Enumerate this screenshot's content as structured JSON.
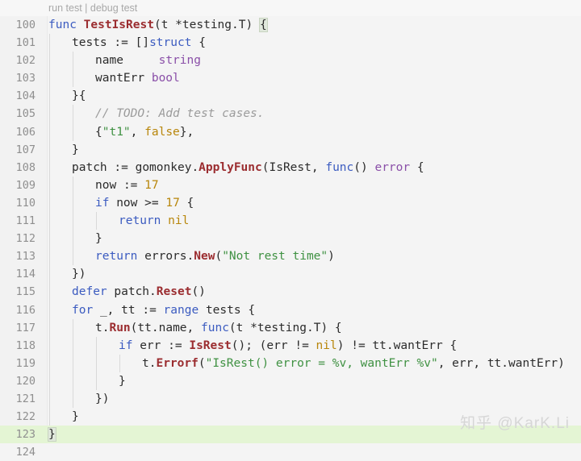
{
  "gutter_header": {
    "run_label": "run test",
    "separator": " | ",
    "debug_label": "debug test"
  },
  "watermark": "知乎 @KarK.Li",
  "colors": {
    "background": "#f4f4f4",
    "gutter": "#f2f2f2",
    "line_number": "#8f8f8f",
    "highlight_line": "#e4f5d4",
    "keyword": "#3b5bc0",
    "function": "#9b2d30",
    "type": "#8a4fa8",
    "string": "#3f9142",
    "number": "#b8860b",
    "comment": "#9b9b9b",
    "plain": "#2b2b2b",
    "brace_match": "#e0e8dc",
    "watermark": "#d6d6d6"
  },
  "editor": {
    "language": "go",
    "first_line": 100,
    "last_line": 124,
    "highlighted_lines": [
      123
    ],
    "lines": [
      {
        "n": "100",
        "indent": 0,
        "text": "func TestIsRest(t *testing.T) {"
      },
      {
        "n": "101",
        "indent": 1,
        "text": "tests := []struct {"
      },
      {
        "n": "102",
        "indent": 2,
        "text": "name     string"
      },
      {
        "n": "103",
        "indent": 2,
        "text": "wantErr bool"
      },
      {
        "n": "104",
        "indent": 1,
        "text": "}{"
      },
      {
        "n": "105",
        "indent": 2,
        "text": "// TODO: Add test cases."
      },
      {
        "n": "106",
        "indent": 2,
        "text": "{\"t1\", false},"
      },
      {
        "n": "107",
        "indent": 1,
        "text": "}"
      },
      {
        "n": "108",
        "indent": 1,
        "text": "patch := gomonkey.ApplyFunc(IsRest, func() error {"
      },
      {
        "n": "109",
        "indent": 2,
        "text": "now := 17"
      },
      {
        "n": "110",
        "indent": 2,
        "text": "if now >= 17 {"
      },
      {
        "n": "111",
        "indent": 3,
        "text": "return nil"
      },
      {
        "n": "112",
        "indent": 2,
        "text": "}"
      },
      {
        "n": "113",
        "indent": 2,
        "text": "return errors.New(\"Not rest time\")"
      },
      {
        "n": "114",
        "indent": 1,
        "text": "})"
      },
      {
        "n": "115",
        "indent": 1,
        "text": "defer patch.Reset()"
      },
      {
        "n": "116",
        "indent": 1,
        "text": "for _, tt := range tests {"
      },
      {
        "n": "117",
        "indent": 2,
        "text": "t.Run(tt.name, func(t *testing.T) {"
      },
      {
        "n": "118",
        "indent": 3,
        "text": "if err := IsRest(); (err != nil) != tt.wantErr {"
      },
      {
        "n": "119",
        "indent": 4,
        "text": "t.Errorf(\"IsRest() error = %v, wantErr %v\", err, tt.wantErr)"
      },
      {
        "n": "120",
        "indent": 3,
        "text": "}"
      },
      {
        "n": "121",
        "indent": 2,
        "text": "})"
      },
      {
        "n": "122",
        "indent": 1,
        "text": "}"
      },
      {
        "n": "123",
        "indent": 0,
        "text": "}"
      },
      {
        "n": "124",
        "indent": 0,
        "text": ""
      }
    ]
  }
}
